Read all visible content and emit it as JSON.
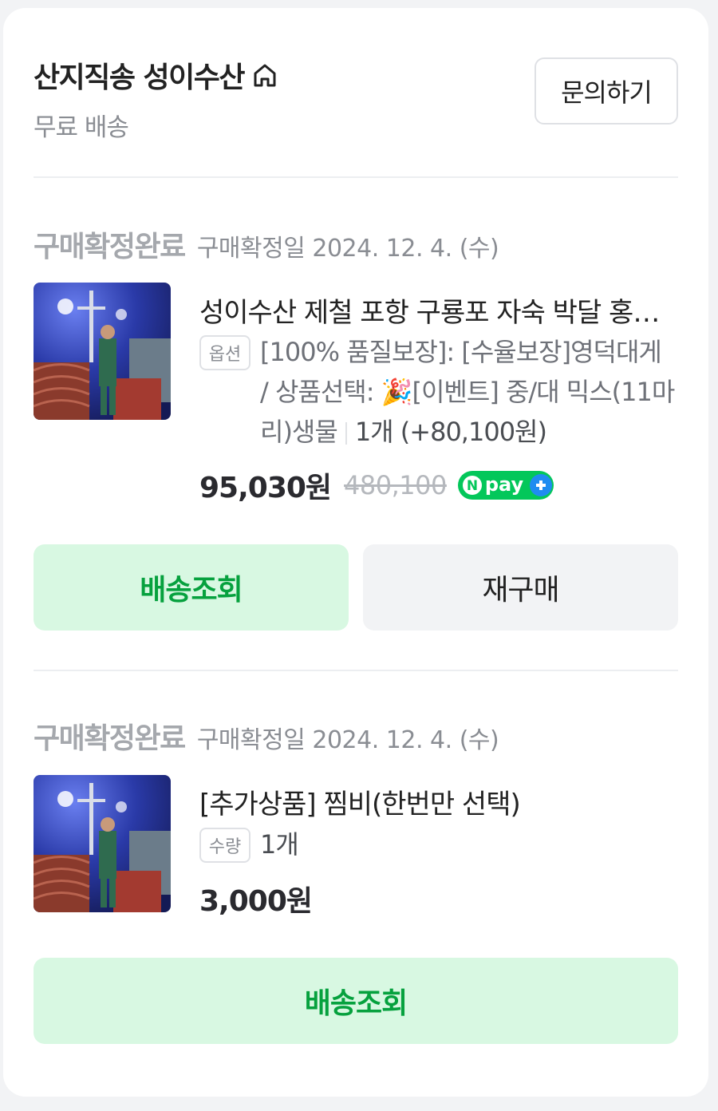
{
  "store": {
    "name": "산지직송 성이수산",
    "shipping": "무료 배송",
    "inquiry_label": "문의하기"
  },
  "orders": [
    {
      "status": "구매확정완료",
      "date": "구매확정일 2024. 12. 4. (수)",
      "title": "성이수산 제철 포항 구룡포 자숙 박달 홍게 대게",
      "option_tag": "옵션",
      "option_text": "[100% 품질보장]: [수율보장]영덕대게 / 상품선택: 🎉[이벤트] 중/대 믹스(11마리)생물",
      "option_qty": "1개 (+80,100원)",
      "price": "95,030원",
      "original_price": "480,100",
      "pay_badge": "pay",
      "buttons": {
        "track": "배송조회",
        "rebuy": "재구매"
      }
    },
    {
      "status": "구매확정완료",
      "date": "구매확정일 2024. 12. 4. (수)",
      "title": "[추가상품] 찜비(한번만 선택)",
      "option_tag": "수량",
      "option_text": "1개",
      "price": "3,000원",
      "buttons": {
        "track": "배송조회"
      }
    }
  ],
  "colors": {
    "accent_green": "#03c75a",
    "track_button_bg": "#d8f8e2",
    "track_button_text": "#06a13e"
  }
}
